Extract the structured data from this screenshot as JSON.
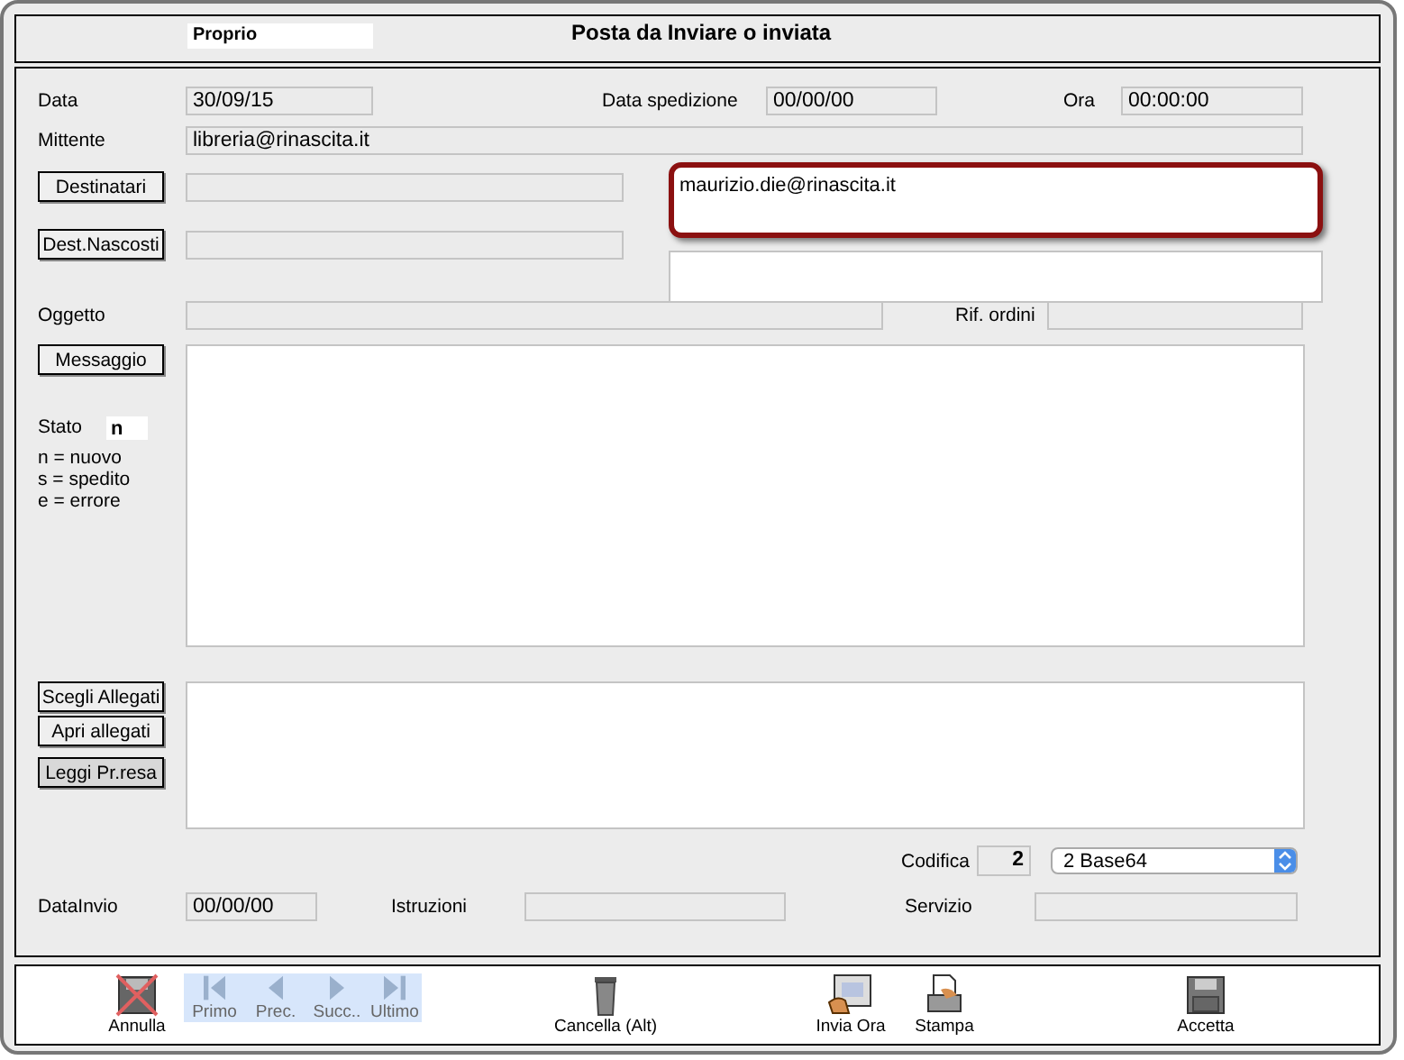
{
  "header": {
    "owner_field": "Proprio",
    "title": "Posta da Inviare o inviata"
  },
  "date": {
    "label": "Data",
    "value": "30/09/15"
  },
  "ship_date": {
    "label": "Data spedizione",
    "value": "00/00/00"
  },
  "time": {
    "label": "Ora",
    "value": "00:00:00"
  },
  "sender": {
    "label": "Mittente",
    "value": "libreria@rinascita.it"
  },
  "recipients_button": "Destinatari",
  "hidden_recipients_button": "Dest.Nascosti",
  "recipients_box": {
    "value": "maurizio.die@rinascita.it",
    "highlighted": true
  },
  "subject": {
    "label": "Oggetto"
  },
  "order_ref": {
    "label": "Rif. ordini"
  },
  "message_button": "Messaggio",
  "status": {
    "label": "Stato",
    "value": "n",
    "legend": [
      "n = nuovo",
      "s = spedito",
      "e = errore"
    ]
  },
  "attachment_buttons": [
    "Scegli Allegati",
    "Apri allegati",
    "Leggi Pr.resa"
  ],
  "encoding": {
    "label": "Codifica",
    "value": "2",
    "select": "2 Base64"
  },
  "send_date": {
    "label": "DataInvio",
    "value": "00/00/00"
  },
  "instructions": {
    "label": "Istruzioni"
  },
  "service": {
    "label": "Servizio"
  },
  "toolbar": [
    {
      "kind": "cancel",
      "label": "Annulla",
      "disabled": false
    },
    {
      "kind": "first",
      "label": "Primo",
      "disabled": true
    },
    {
      "kind": "prev",
      "label": "Prec.",
      "disabled": true
    },
    {
      "kind": "next",
      "label": "Succ..",
      "disabled": true
    },
    {
      "kind": "last",
      "label": "Ultimo",
      "disabled": true
    },
    {
      "kind": "trash",
      "label": "Cancella (Alt)",
      "disabled": false
    },
    {
      "kind": "send",
      "label": "Invia Ora",
      "disabled": false
    },
    {
      "kind": "print",
      "label": "Stampa",
      "disabled": false
    },
    {
      "kind": "accept",
      "label": "Accetta",
      "disabled": false
    }
  ]
}
